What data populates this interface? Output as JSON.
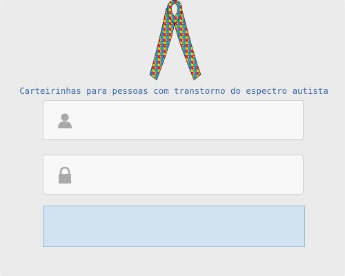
{
  "header": {
    "subtitle": "Carteirinhas para pessoas com transtorno do espectro autista",
    "logo_icon": "autism-awareness-puzzle-ribbon-icon"
  },
  "form": {
    "username": {
      "icon": "user-icon",
      "value": "",
      "placeholder": ""
    },
    "password": {
      "icon": "lock-icon",
      "value": "",
      "placeholder": ""
    },
    "submit_label": ""
  },
  "colors": {
    "background": "#ebebeb",
    "subtitle_text": "#3a6ab0",
    "input_background": "#f8f8f8",
    "input_border": "#cfcfcf",
    "icon": "#a9a9a9",
    "button_background": "#d3e2f1",
    "button_border": "#9fb6cf",
    "ribbon_red": "#d62d2d",
    "ribbon_blue": "#2f7fc8",
    "ribbon_yellow": "#f3c514",
    "ribbon_teal": "#2aa6a6"
  }
}
